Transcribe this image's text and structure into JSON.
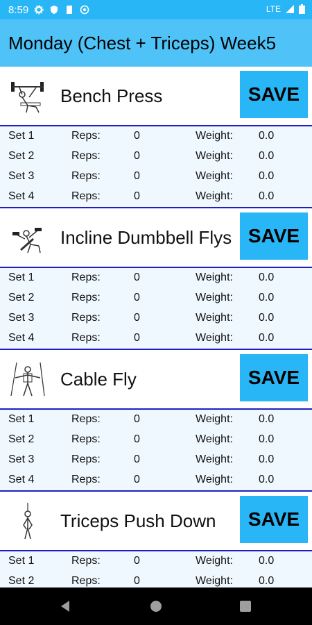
{
  "status": {
    "time": "8:59",
    "network": "LTE"
  },
  "appbar": {
    "title": "Monday (Chest + Triceps) Week5"
  },
  "labels": {
    "reps": "Reps:",
    "weight": "Weight:",
    "save": "SAVE"
  },
  "exercises": [
    {
      "name": "Bench Press",
      "icon": "bench-press-icon",
      "sets": [
        {
          "set": "Set 1",
          "reps": "0",
          "weight": "0.0"
        },
        {
          "set": "Set 2",
          "reps": "0",
          "weight": "0.0"
        },
        {
          "set": "Set 3",
          "reps": "0",
          "weight": "0.0"
        },
        {
          "set": "Set 4",
          "reps": "0",
          "weight": "0.0"
        }
      ]
    },
    {
      "name": "Incline Dumbbell Flys",
      "icon": "incline-dumbbell-flys-icon",
      "sets": [
        {
          "set": "Set 1",
          "reps": "0",
          "weight": "0.0"
        },
        {
          "set": "Set 2",
          "reps": "0",
          "weight": "0.0"
        },
        {
          "set": "Set 3",
          "reps": "0",
          "weight": "0.0"
        },
        {
          "set": "Set 4",
          "reps": "0",
          "weight": "0.0"
        }
      ]
    },
    {
      "name": "Cable Fly",
      "icon": "cable-fly-icon",
      "sets": [
        {
          "set": "Set 1",
          "reps": "0",
          "weight": "0.0"
        },
        {
          "set": "Set 2",
          "reps": "0",
          "weight": "0.0"
        },
        {
          "set": "Set 3",
          "reps": "0",
          "weight": "0.0"
        },
        {
          "set": "Set 4",
          "reps": "0",
          "weight": "0.0"
        }
      ]
    },
    {
      "name": "Triceps Push Down",
      "icon": "triceps-push-down-icon",
      "sets": [
        {
          "set": "Set 1",
          "reps": "0",
          "weight": "0.0"
        },
        {
          "set": "Set 2",
          "reps": "0",
          "weight": "0.0"
        }
      ]
    }
  ],
  "colors": {
    "statusbar": "#29b6f6",
    "appbar": "#4fc3f7",
    "save_button": "#29b6f6",
    "divider": "#1f1fbf",
    "row_bg": "#f0f8ff"
  }
}
